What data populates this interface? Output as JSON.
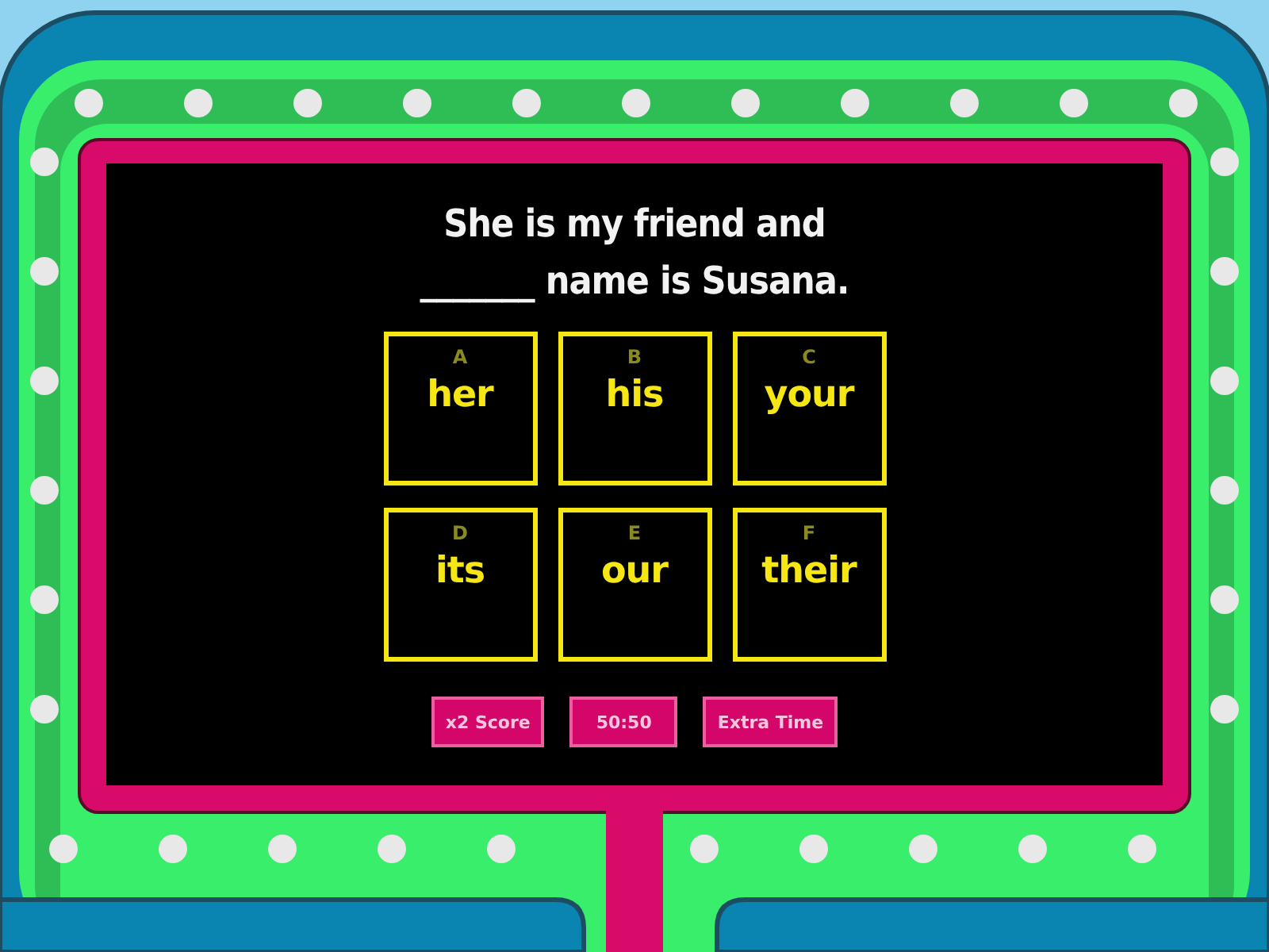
{
  "question": "She is my friend and _______ name is Susana.",
  "answers": [
    {
      "letter": "A",
      "text": "her"
    },
    {
      "letter": "B",
      "text": "his"
    },
    {
      "letter": "C",
      "text": "your"
    },
    {
      "letter": "D",
      "text": "its"
    },
    {
      "letter": "E",
      "text": "our"
    },
    {
      "letter": "F",
      "text": "their"
    }
  ],
  "powerups": [
    "x2 Score",
    "50:50",
    "Extra Time"
  ]
}
